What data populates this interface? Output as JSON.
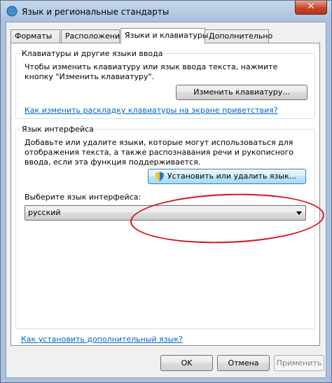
{
  "window": {
    "title": "Язык и региональные стандарты",
    "close_glyph": "✕"
  },
  "tabs": [
    {
      "label": "Форматы",
      "active": false
    },
    {
      "label": "Расположение",
      "active": false
    },
    {
      "label": "Языки и клавиатуры",
      "active": true
    },
    {
      "label": "Дополнительно",
      "active": false
    }
  ],
  "keyboards_group": {
    "title": "Клавиатуры и другие языки ввода",
    "description": "Чтобы изменить клавиатуру или язык ввода текста, нажмите кнопку \"Изменить клавиатуру\".",
    "change_button": "Изменить клавиатуру...",
    "welcome_link": "Как изменить раскладку клавиатуры на экране приветствия?"
  },
  "interface_group": {
    "title": "Язык интерфейса",
    "description": "Добавьте или удалите языки, которые могут использоваться для отображения текста, а также распознавания речи и рукописного ввода, если эта функция поддерживается.",
    "install_button": "Установить или удалить язык...",
    "select_label": "Выберите язык интерфейса:",
    "selected_language": "русский"
  },
  "more_languages_link": "Как установить дополнительный язык?",
  "buttons": {
    "ok": "OK",
    "cancel": "Отмена",
    "apply": "Применить"
  },
  "colors": {
    "highlight_ellipse": "#d8101c",
    "link": "#0066cc"
  }
}
